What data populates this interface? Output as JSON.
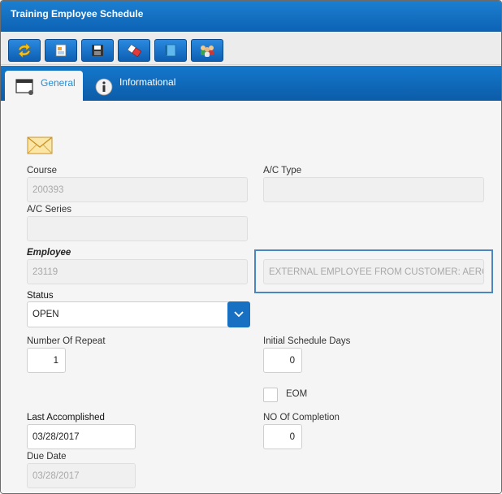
{
  "window": {
    "title": "Training Employee Schedule"
  },
  "toolbar": {
    "buttons": [
      {
        "icon": "refresh-arrows-icon"
      },
      {
        "icon": "new-record-icon"
      },
      {
        "icon": "save-disk-icon"
      },
      {
        "icon": "eraser-icon"
      },
      {
        "icon": "notebook-icon"
      },
      {
        "icon": "group-users-icon"
      }
    ]
  },
  "tabs": [
    {
      "label": "General",
      "active": true,
      "icon": "window-icon"
    },
    {
      "label": "Informational",
      "active": false,
      "icon": "info-icon"
    }
  ],
  "form": {
    "email_icon": "envelope-icon",
    "course": {
      "label": "Course",
      "value": "200393"
    },
    "ac_type": {
      "label": "A/C Type",
      "value": ""
    },
    "ac_series": {
      "label": "A/C Series",
      "value": ""
    },
    "employee": {
      "label": "Employee",
      "value": "23119",
      "name": "EXTERNAL EMPLOYEE FROM CUSTOMER: AEROMA"
    },
    "status": {
      "label": "Status",
      "value": "OPEN"
    },
    "number_of_repeat": {
      "label": "Number Of Repeat",
      "value": "1"
    },
    "initial_schedule_days": {
      "label": "Initial Schedule Days",
      "value": "0"
    },
    "eom": {
      "label": "EOM",
      "checked": false
    },
    "last_accomplished": {
      "label": "Last Accomplished",
      "value": "03/28/2017"
    },
    "no_of_completion": {
      "label": "NO Of Completion",
      "value": "0"
    },
    "due_date": {
      "label": "Due Date",
      "value": "03/28/2017"
    }
  },
  "colors": {
    "accent": "#0d63b5",
    "tab_active_text": "#2a8ad0",
    "highlight_border": "#4a86c0"
  }
}
